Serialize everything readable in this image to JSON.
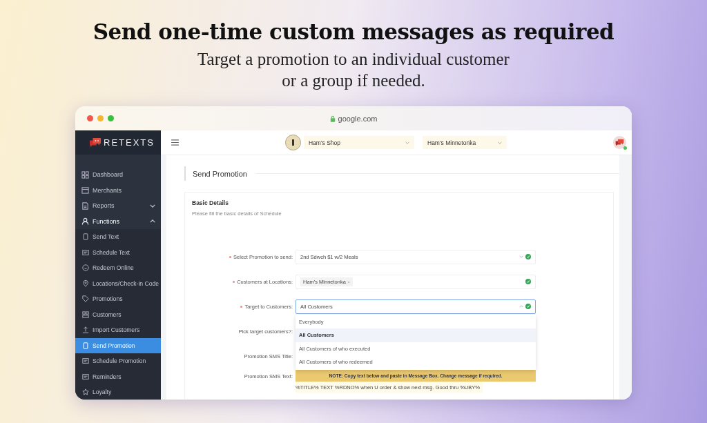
{
  "headline": "Send one-time custom messages as required",
  "subheadline": [
    "Target a promotion to an individual customer",
    "or a group if needed."
  ],
  "browser": {
    "url": "google.com"
  },
  "app": {
    "logo": "RETEXTS",
    "shop_select": "Ham's Shop",
    "location_select": "Ham's Minnetonka",
    "sidebar": [
      {
        "label": "Dashboard",
        "selected": false
      },
      {
        "label": "Merchants",
        "selected": false
      },
      {
        "label": "Reports",
        "selected": false,
        "expanded": false
      },
      {
        "label": "Functions",
        "selected": false,
        "expanded": true,
        "children": [
          {
            "label": "Send Text",
            "selected": false
          },
          {
            "label": "Schedule Text",
            "selected": false
          },
          {
            "label": "Redeem Online",
            "selected": false
          },
          {
            "label": "Locations/Check-in Code",
            "selected": false
          },
          {
            "label": "Promotions",
            "selected": false
          },
          {
            "label": "Customers",
            "selected": false
          },
          {
            "label": "Import Customers",
            "selected": false
          },
          {
            "label": "Send Promotion",
            "selected": true
          },
          {
            "label": "Schedule Promotion",
            "selected": false
          },
          {
            "label": "Reminders",
            "selected": false
          },
          {
            "label": "Loyalty",
            "selected": false
          }
        ]
      }
    ],
    "page_title": "Send Promotion",
    "section": {
      "title": "Basic Details",
      "subtitle": "Please fill the basic details of Schedule"
    },
    "form": [
      {
        "kind": "select",
        "label": "Select Promotion to send:",
        "required": true,
        "value": "2nd Sdwch $1 w/2 Meals",
        "valid": true,
        "open": false
      },
      {
        "kind": "tags",
        "label": "Customers at Locations:",
        "required": true,
        "tags": [
          "Ham's Minnetonka"
        ],
        "valid": true
      },
      {
        "kind": "select",
        "label": "Target to Customers:",
        "required": true,
        "value": "All Customers",
        "valid": true,
        "open": true,
        "options": [
          {
            "label": "Everybody",
            "selected": false
          },
          {
            "label": "All Customers",
            "selected": true
          },
          {
            "label": "All Customers of who executed",
            "selected": false
          },
          {
            "label": "All Customers of who redeemed",
            "selected": false
          }
        ]
      },
      {
        "kind": "blank",
        "label": "Pick target customers?:",
        "required": false
      },
      {
        "kind": "blank",
        "label": "Promotion SMS Title:",
        "required": false
      },
      {
        "kind": "sms",
        "label": "Promotion SMS Text:",
        "required": false,
        "note": "NOTE: Copy text below and paste in Message Box. Change message if required.",
        "text": "%TITLE% TEXT %RDNO% when U order & show next msg. Good thru %UBY%"
      }
    ]
  }
}
